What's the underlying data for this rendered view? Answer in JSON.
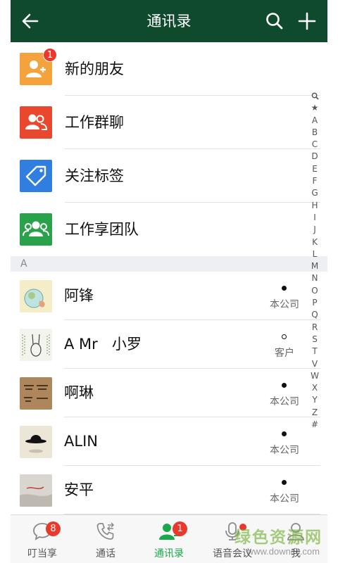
{
  "header": {
    "title": "通讯录",
    "back_icon": "arrow-left-icon",
    "search_icon": "search-icon",
    "add_icon": "plus-icon",
    "background": "#0f4a2c"
  },
  "functions": [
    {
      "label": "新的朋友",
      "icon": "add-friend-icon",
      "color": "#f4a23c",
      "badge": "1"
    },
    {
      "label": "工作群聊",
      "icon": "group-chat-icon",
      "color": "#e9482f",
      "badge": ""
    },
    {
      "label": "关注标签",
      "icon": "tag-icon",
      "color": "#2f7ee0",
      "badge": ""
    },
    {
      "label": "工作享团队",
      "icon": "team-icon",
      "color": "#2aa24a",
      "badge": ""
    }
  ],
  "section_letter": "A",
  "contacts": [
    {
      "name": "阿锋",
      "tag": "本公司",
      "dot": "filled"
    },
    {
      "name": "A Mr   小罗",
      "tag": "客户",
      "dot": "hollow"
    },
    {
      "name": "啊琳",
      "tag": "本公司",
      "dot": "filled"
    },
    {
      "name": "ALIN",
      "tag": "本公司",
      "dot": "filled"
    },
    {
      "name": "安平",
      "tag": "本公司",
      "dot": "filled"
    }
  ],
  "index_letters": [
    "🔍",
    "★",
    "A",
    "B",
    "C",
    "D",
    "E",
    "F",
    "G",
    "H",
    "I",
    "J",
    "K",
    "L",
    "M",
    "N",
    "O",
    "P",
    "Q",
    "R",
    "S",
    "T",
    "V",
    "W",
    "X",
    "Y",
    "Z",
    "#"
  ],
  "tabs": [
    {
      "label": "叮当享",
      "icon": "chat-bubble-icon",
      "badge": "8"
    },
    {
      "label": "通话",
      "icon": "phone-icon",
      "badge": ""
    },
    {
      "label": "通讯录",
      "icon": "contacts-icon",
      "badge": "1"
    },
    {
      "label": "语音会议",
      "icon": "microphone-icon",
      "badge": ""
    },
    {
      "label": "我",
      "icon": "profile-icon",
      "badge": ""
    }
  ],
  "watermark": {
    "main": "绿色资源网",
    "sub": "www.downcc.com"
  },
  "colors": {
    "accent": "#1aa84a",
    "badge": "#e8392c"
  }
}
